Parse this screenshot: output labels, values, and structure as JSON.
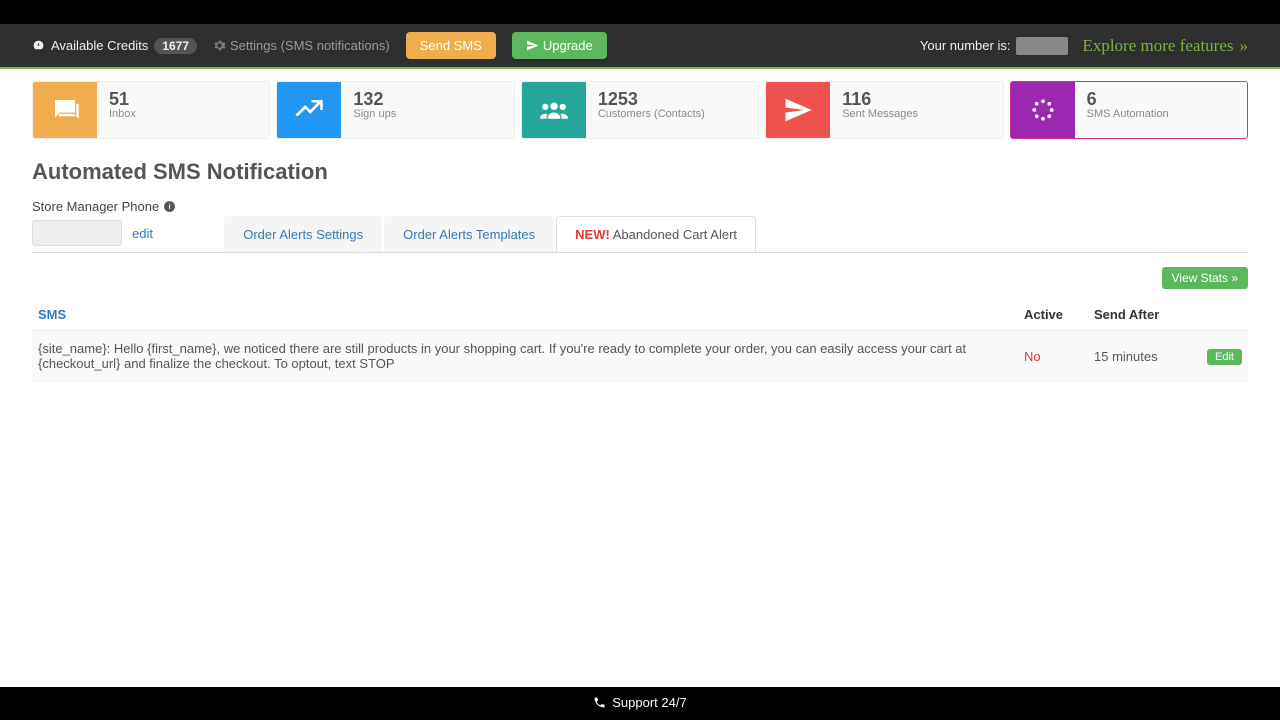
{
  "header": {
    "credits_label": "Available Credits",
    "credits_count": "1677",
    "settings_label": "Settings (SMS notifications)",
    "send_sms": "Send SMS",
    "upgrade": "Upgrade",
    "your_number_label": "Your number is:",
    "explore": "Explore more features"
  },
  "stats": [
    {
      "value": "51",
      "label": "Inbox"
    },
    {
      "value": "132",
      "label": "Sign ups"
    },
    {
      "value": "1253",
      "label": "Customers (Contacts)"
    },
    {
      "value": "116",
      "label": "Sent Messages"
    },
    {
      "value": "6",
      "label": "SMS Automation"
    }
  ],
  "page": {
    "title": "Automated SMS Notification",
    "phone_label": "Store Manager Phone",
    "edit": "edit"
  },
  "tabs": {
    "order_settings": "Order Alerts Settings",
    "order_templates": "Order Alerts Templates",
    "new": "NEW!",
    "abandoned": " Abandoned Cart Alert"
  },
  "table": {
    "view_stats": "View Stats »",
    "cols": {
      "sms": "SMS",
      "active": "Active",
      "send_after": "Send After"
    },
    "rows": [
      {
        "sms": "{site_name}: Hello {first_name}, we noticed there are still products in your shopping cart. If you're ready to complete your order, you can easily access your cart at {checkout_url} and finalize the checkout. To optout, text STOP",
        "active": "No",
        "send_after": "15 minutes",
        "edit": "Edit"
      }
    ]
  },
  "footer": {
    "support": "Support 24/7"
  }
}
